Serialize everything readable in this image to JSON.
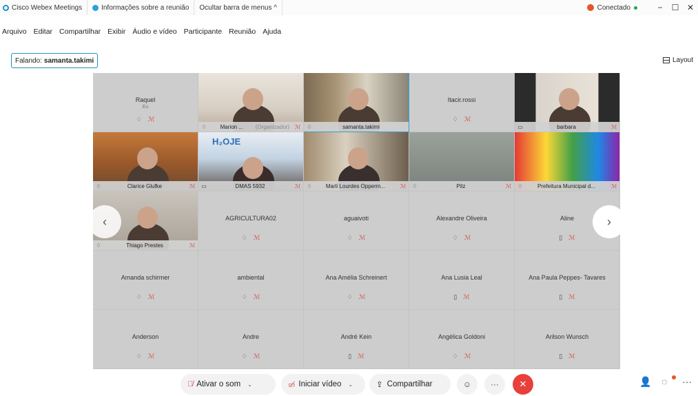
{
  "titlebar": {
    "app_name": "Cisco Webex Meetings",
    "meeting_info": "Informações sobre a reunião",
    "hide_menu": "Ocultar barra de menus ^",
    "status": "Conectado",
    "minimize": "−",
    "maximize": "☐",
    "close": "✕"
  },
  "menu": [
    "Arquivo",
    "Editar",
    "Compartilhar",
    "Exibir",
    "Áudio e vídeo",
    "Participante",
    "Reunião",
    "Ajuda"
  ],
  "speaking": {
    "label": "Falando:",
    "name": "samanta.takimi"
  },
  "layout_label": "Layout",
  "tiles": [
    {
      "name": "Raquel",
      "sub": "Eu",
      "kind": "name"
    },
    {
      "name": "Marion ...",
      "organizer": "(Organizador)",
      "kind": "video"
    },
    {
      "name": "samanta.takimi",
      "kind": "video",
      "active": true
    },
    {
      "name": "Itacir.rossi",
      "kind": "name"
    },
    {
      "name": "barbara",
      "kind": "video"
    },
    {
      "name": "Clarice Glufke",
      "kind": "video"
    },
    {
      "name": "DMAS 5932",
      "kind": "video"
    },
    {
      "name": "Marli Lourdes Opperm...",
      "kind": "video"
    },
    {
      "name": "Pilz",
      "kind": "video-dark"
    },
    {
      "name": "Prefeitura Municipal d...",
      "kind": "video"
    },
    {
      "name": "Thiago Prestes",
      "kind": "video"
    },
    {
      "name": "AGRICULTURA02",
      "kind": "name"
    },
    {
      "name": "aguaivoti",
      "kind": "name"
    },
    {
      "name": "Alexandre Oliveira",
      "kind": "name"
    },
    {
      "name": "Aline",
      "kind": "name"
    },
    {
      "name": "Amanda schirmer",
      "kind": "name"
    },
    {
      "name": "ambiental",
      "kind": "name"
    },
    {
      "name": "Ana Amélia Schreinert",
      "kind": "name"
    },
    {
      "name": "Ana Lusia Leal",
      "kind": "name"
    },
    {
      "name": "Ana Paula Peppes- Tavares",
      "kind": "name"
    },
    {
      "name": "Anderson",
      "kind": "name"
    },
    {
      "name": "Andre",
      "kind": "name"
    },
    {
      "name": "André Kein",
      "kind": "name"
    },
    {
      "name": "Angélica Goldoni",
      "kind": "name"
    },
    {
      "name": "Arilson Wunsch",
      "kind": "name"
    }
  ],
  "toolbar": {
    "unmute": "Ativar o som",
    "start_video": "Iniciar vídeo",
    "share": "Compartilhar"
  },
  "video_banner": "H₂OJE",
  "colors": {
    "accent": "#2ea0d6",
    "end": "#e8403d",
    "mic_off": "#d64545",
    "connected": "#21a35a"
  }
}
